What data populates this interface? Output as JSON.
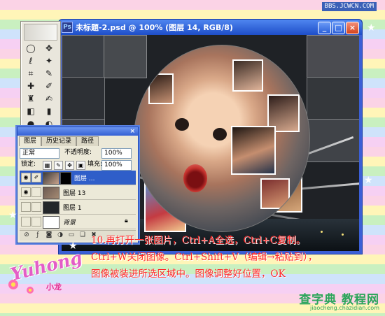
{
  "site_url": "BBS.JCWCN.COM",
  "document_window": {
    "title": "未标题-2.psd @ 100% (图层 14, RGB/8)",
    "app_icon_text": "Ps",
    "min_label": "_",
    "max_label": "□",
    "close_label": "×"
  },
  "layers_panel": {
    "tabs": [
      "图层",
      "历史记录",
      "路径"
    ],
    "blend_mode": "正常",
    "opacity_label": "不透明度:",
    "opacity_value": "100%",
    "lock_label": "锁定:",
    "fill_label": "填充:",
    "fill_value": "100%",
    "layers": [
      {
        "name": "图层 ...",
        "active": true
      },
      {
        "name": "图层 13",
        "active": false
      },
      {
        "name": "图层 1",
        "active": false
      },
      {
        "name": "背景",
        "active": false
      }
    ]
  },
  "logo": {
    "text": "Yuhong",
    "sub": "小龙"
  },
  "caption_lines": [
    "10.再打开一张图片，Ctrl+A全选，Ctrl+C复制。",
    "Ctrl+W关闭图像。Ctrl+Shift+V（编辑→粘贴到），",
    "图像被装进所选区域中。图像调整好位置，OK"
  ],
  "watermark": {
    "main": "查字典 教程网",
    "sub": "jiaocheng.chazidian.com"
  },
  "colors": {
    "caption": "#ff2727",
    "title_bar": "#1e4ec8",
    "active_layer": "#2f5ec9"
  }
}
